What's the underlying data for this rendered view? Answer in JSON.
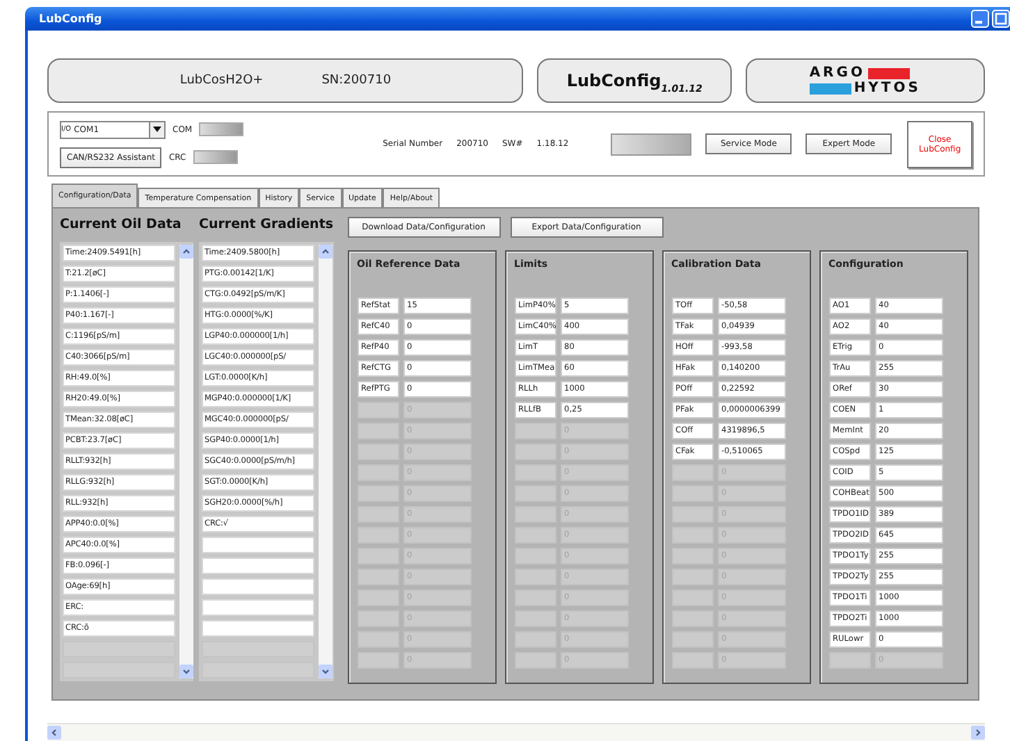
{
  "window": {
    "title": "LubConfig"
  },
  "header": {
    "device": "LubCosH2O+",
    "serial": "SN:200710",
    "app_name": "LubConfig",
    "app_version": "1.01.12",
    "logo_top": "ARGO",
    "logo_bottom": "HYTOS"
  },
  "connection": {
    "port_prefix": "I/O",
    "port": "COM1",
    "com_label": "COM",
    "crc_label": "CRC",
    "assistant_button": "CAN/RS232 Assistant"
  },
  "info": {
    "serial_label": "Serial Number",
    "serial_value": "200710",
    "sw_label": "SW#",
    "sw_value": "1.18.12"
  },
  "mode_buttons": [
    "Service Mode",
    "Expert Mode"
  ],
  "close_button": [
    "Close",
    "LubConfig"
  ],
  "tabs": [
    {
      "label": "Configuration/Data",
      "selected": true
    },
    {
      "label": "Temperature Compensation",
      "selected": false
    },
    {
      "label": "History",
      "selected": false
    },
    {
      "label": "Service",
      "selected": false
    },
    {
      "label": "Update",
      "selected": false
    },
    {
      "label": "Help/About",
      "selected": false
    }
  ],
  "lists": [
    {
      "title": "Current Oil Data",
      "items": [
        {
          "text": "Time:2409.5491[h]",
          "disabled": false
        },
        {
          "text": "T:21.2[øC]",
          "disabled": false
        },
        {
          "text": "P:1.1406[-]",
          "disabled": false
        },
        {
          "text": "P40:1.167[-]",
          "disabled": false
        },
        {
          "text": "C:1196[pS/m]",
          "disabled": false
        },
        {
          "text": "C40:3066[pS/m]",
          "disabled": false
        },
        {
          "text": "RH:49.0[%]",
          "disabled": false
        },
        {
          "text": "RH20:49.0[%]",
          "disabled": false
        },
        {
          "text": "TMean:32.08[øC]",
          "disabled": false
        },
        {
          "text": "PCBT:23.7[øC]",
          "disabled": false
        },
        {
          "text": "RLLT:932[h]",
          "disabled": false
        },
        {
          "text": "RLLG:932[h]",
          "disabled": false
        },
        {
          "text": "RLL:932[h]",
          "disabled": false
        },
        {
          "text": "APP40:0.0[%]",
          "disabled": false
        },
        {
          "text": "APC40:0.0[%]",
          "disabled": false
        },
        {
          "text": "FB:0.096[-]",
          "disabled": false
        },
        {
          "text": "OAge:69[h]",
          "disabled": false
        },
        {
          "text": "ERC:",
          "disabled": false
        },
        {
          "text": "CRC:õ",
          "disabled": false
        },
        {
          "disabled": true
        },
        {
          "disabled": true
        }
      ]
    },
    {
      "title": "Current Gradients",
      "items": [
        {
          "text": "Time:2409.5800[h]",
          "disabled": false
        },
        {
          "text": "PTG:0.00142[1/K]",
          "disabled": false
        },
        {
          "text": "CTG:0.0492[pS/m/K]",
          "disabled": false
        },
        {
          "text": "HTG:0.0000[%/K]",
          "disabled": false
        },
        {
          "text": "LGP40:0.000000[1/h]",
          "disabled": false
        },
        {
          "text": "LGC40:0.000000[pS/",
          "disabled": false
        },
        {
          "text": "LGT:0.0000[K/h]",
          "disabled": false
        },
        {
          "text": "MGP40:0.000000[1/K]",
          "disabled": false
        },
        {
          "text": "MGC40:0.000000[pS/",
          "disabled": false
        },
        {
          "text": "SGP40:0.0000[1/h]",
          "disabled": false
        },
        {
          "text": "SGC40:0.0000[pS/m/h]",
          "disabled": false
        },
        {
          "text": "SGT:0.0000[K/h]",
          "disabled": false
        },
        {
          "text": "SGH20:0.0000[%/h]",
          "disabled": false
        },
        {
          "text": "CRC:√",
          "disabled": false
        },
        {
          "disabled": false
        },
        {
          "disabled": false
        },
        {
          "disabled": false
        },
        {
          "disabled": false
        },
        {
          "disabled": false
        },
        {
          "disabled": true
        },
        {
          "disabled": true
        }
      ]
    }
  ],
  "action_buttons": [
    "Download Data/Configuration",
    "Export Data/Configuration"
  ],
  "groups": [
    {
      "title": "Oil Reference Data",
      "rows": [
        {
          "label": "RefStat",
          "value": "15",
          "disabled": false
        },
        {
          "label": "RefC40",
          "value": "0",
          "disabled": false
        },
        {
          "label": "RefP40",
          "value": "0",
          "disabled": false
        },
        {
          "label": "RefCTG",
          "value": "0",
          "disabled": false
        },
        {
          "label": "RefPTG",
          "value": "0",
          "disabled": false
        },
        {
          "value": "0",
          "disabled": true
        },
        {
          "value": "0",
          "disabled": true
        },
        {
          "value": "0",
          "disabled": true
        },
        {
          "value": "0",
          "disabled": true
        },
        {
          "value": "0",
          "disabled": true
        },
        {
          "value": "0",
          "disabled": true
        },
        {
          "value": "0",
          "disabled": true
        },
        {
          "value": "0",
          "disabled": true
        },
        {
          "value": "0",
          "disabled": true
        },
        {
          "value": "0",
          "disabled": true
        },
        {
          "value": "0",
          "disabled": true
        },
        {
          "value": "0",
          "disabled": true
        },
        {
          "value": "0",
          "disabled": true
        }
      ]
    },
    {
      "title": "Limits",
      "rows": [
        {
          "label": "LimP40%",
          "value": "5",
          "disabled": false
        },
        {
          "label": "LimC40%",
          "value": "400",
          "disabled": false
        },
        {
          "label": "LimT",
          "value": "80",
          "disabled": false
        },
        {
          "label": "LimTMea",
          "value": "60",
          "disabled": false
        },
        {
          "label": "RLLh",
          "value": "1000",
          "disabled": false
        },
        {
          "label": "RLLfB",
          "value": "0,25",
          "disabled": false
        },
        {
          "value": "0",
          "disabled": true
        },
        {
          "value": "0",
          "disabled": true
        },
        {
          "value": "0",
          "disabled": true
        },
        {
          "value": "0",
          "disabled": true
        },
        {
          "value": "0",
          "disabled": true
        },
        {
          "value": "0",
          "disabled": true
        },
        {
          "value": "0",
          "disabled": true
        },
        {
          "value": "0",
          "disabled": true
        },
        {
          "value": "0",
          "disabled": true
        },
        {
          "value": "0",
          "disabled": true
        },
        {
          "value": "0",
          "disabled": true
        },
        {
          "value": "0",
          "disabled": true
        }
      ]
    },
    {
      "title": "Calibration Data",
      "rows": [
        {
          "label": "TOff",
          "value": "-50,58",
          "disabled": false
        },
        {
          "label": "TFak",
          "value": "0,04939",
          "disabled": false
        },
        {
          "label": "HOff",
          "value": "-993,58",
          "disabled": false
        },
        {
          "label": "HFak",
          "value": "0,140200",
          "disabled": false
        },
        {
          "label": "POff",
          "value": "0,22592",
          "disabled": false
        },
        {
          "label": "PFak",
          "value": "0,0000006399",
          "disabled": false
        },
        {
          "label": "COff",
          "value": "4319896,5",
          "disabled": false
        },
        {
          "label": "CFak",
          "value": "-0,510065",
          "disabled": false
        },
        {
          "value": "0",
          "disabled": true
        },
        {
          "value": "0",
          "disabled": true
        },
        {
          "value": "0",
          "disabled": true
        },
        {
          "value": "0",
          "disabled": true
        },
        {
          "value": "0",
          "disabled": true
        },
        {
          "value": "0",
          "disabled": true
        },
        {
          "value": "0",
          "disabled": true
        },
        {
          "value": "0",
          "disabled": true
        },
        {
          "value": "0",
          "disabled": true
        },
        {
          "value": "0",
          "disabled": true
        }
      ]
    },
    {
      "title": "Configuration",
      "rows": [
        {
          "label": "AO1",
          "value": "40",
          "disabled": false
        },
        {
          "label": "AO2",
          "value": "40",
          "disabled": false
        },
        {
          "label": "ETrig",
          "value": "0",
          "disabled": false
        },
        {
          "label": "TrAu",
          "value": "255",
          "disabled": false
        },
        {
          "label": "ORef",
          "value": "30",
          "disabled": false
        },
        {
          "label": "COEN",
          "value": "1",
          "disabled": false
        },
        {
          "label": "MemInt",
          "value": "20",
          "disabled": false
        },
        {
          "label": "COSpd",
          "value": "125",
          "disabled": false
        },
        {
          "label": "COID",
          "value": "5",
          "disabled": false
        },
        {
          "label": "COHBeat",
          "value": "500",
          "disabled": false
        },
        {
          "label": "TPDO1ID",
          "value": "389",
          "disabled": false
        },
        {
          "label": "TPDO2ID",
          "value": "645",
          "disabled": false
        },
        {
          "label": "TPDO1Ty",
          "value": "255",
          "disabled": false
        },
        {
          "label": "TPDO2Ty",
          "value": "255",
          "disabled": false
        },
        {
          "label": "TPDO1Ti",
          "value": "1000",
          "disabled": false
        },
        {
          "label": "TPDO2Ti",
          "value": "1000",
          "disabled": false
        },
        {
          "label": "RULowr",
          "value": "0",
          "disabled": false
        },
        {
          "value": "0",
          "disabled": true
        }
      ]
    }
  ]
}
